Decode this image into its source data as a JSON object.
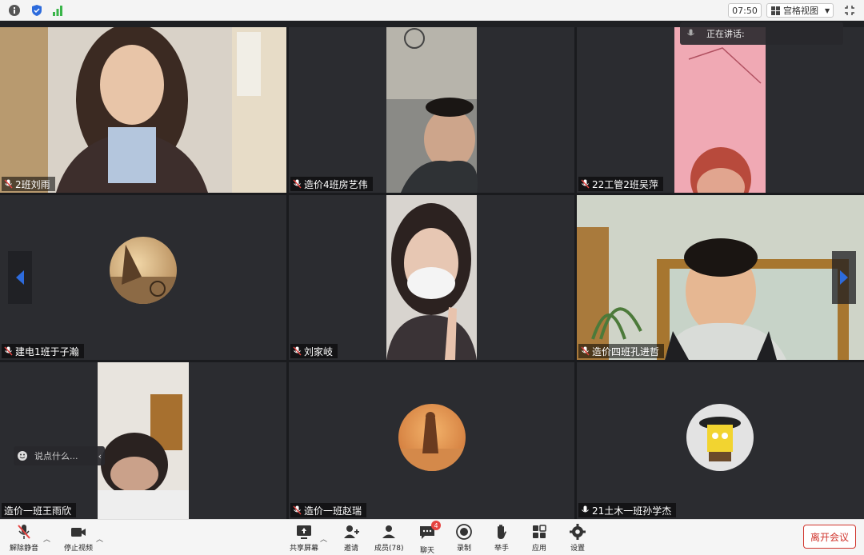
{
  "topbar": {
    "clock": "07:50",
    "view_label": "宫格视图"
  },
  "talking": {
    "label": "正在讲话:"
  },
  "tiles": [
    {
      "name": "2班刘雨"
    },
    {
      "name": "造价4班房艺伟"
    },
    {
      "name": "22工管2班吴萍"
    },
    {
      "name": "建电1班于子瀚"
    },
    {
      "name": "刘家岐"
    },
    {
      "name": "造价四班孔进哲"
    },
    {
      "name": "造价一班王雨欣"
    },
    {
      "name": "造价一班赵瑞"
    },
    {
      "name": "21土木一班孙学杰"
    }
  ],
  "chat": {
    "placeholder": "说点什么..."
  },
  "toolbar": {
    "unmute": "解除静音",
    "stop_video": "停止视频",
    "share_screen": "共享屏幕",
    "invite": "邀请",
    "members": "成员(78)",
    "chat": "聊天",
    "chat_badge": "4",
    "record": "录制",
    "raise_hand": "举手",
    "apps": "应用",
    "settings": "设置",
    "leave": "离开会议"
  },
  "colors": {
    "accent": "#2d6bdc",
    "danger": "#d0342c",
    "tile_bg": "#2b2c30"
  }
}
